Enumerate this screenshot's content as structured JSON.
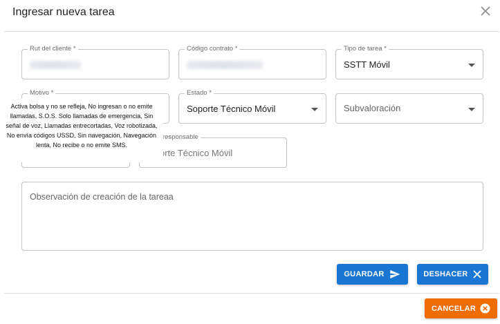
{
  "dialog": {
    "title": "Ingresar nueva tarea"
  },
  "fields": {
    "rut_cliente": {
      "label": "Rut del cliente *"
    },
    "codigo_contrato": {
      "label": "Código contrato *"
    },
    "tipo_tarea": {
      "label": "Tipo de tarea *",
      "value": "SSTT Móvil"
    },
    "motivo": {
      "label": "Motivo *"
    },
    "estado": {
      "label": "Estado *",
      "value": "Soporte Técnico Móvil"
    },
    "subvaloracion": {
      "placeholder": "Subvaloración"
    },
    "area_responsable": {
      "label": "responsable",
      "value": "orte Técnico Móvil"
    },
    "observacion": {
      "placeholder": "Observación de creación de la tareaa"
    }
  },
  "tooltip": {
    "text": "Activa bolsa y no se refleja, No ingresan o no emite llamadas, S.O.S. Solo llamadas de emergencia, Sin señal de voz, Llamadas entrecortadas, Voz robotizada, No envía códigos USSD, Sin navegación, Navegación lenta, No recibe o no emite SMS."
  },
  "buttons": {
    "guardar": "GUARDAR",
    "deshacer": "DESHACER",
    "cancelar": "CANCELAR"
  },
  "colors": {
    "primary": "#1976d2",
    "cancel": "#ef6c00"
  }
}
